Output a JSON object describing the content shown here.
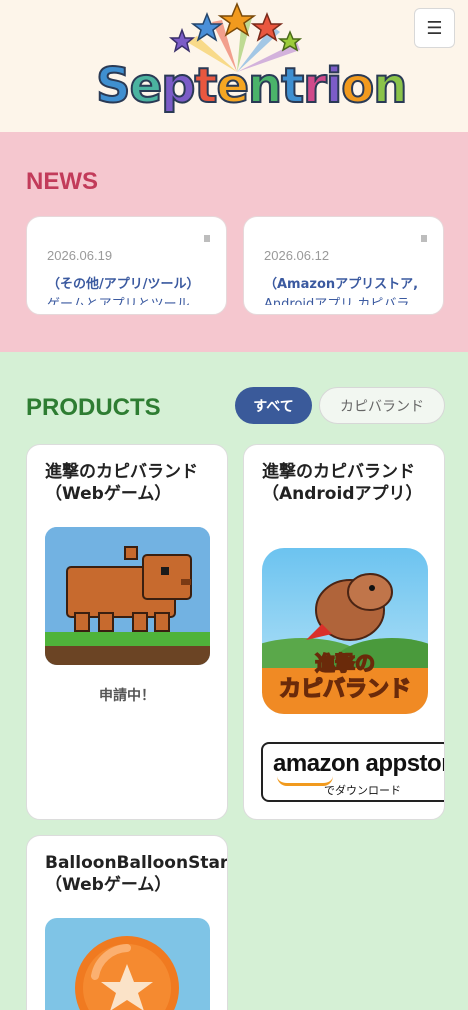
{
  "header": {
    "logo_text": "Septentrion",
    "menu_icon": "☰"
  },
  "news": {
    "title": "NEWS",
    "items": [
      {
        "date": "2026.06.19",
        "category": "（その他/アプリ/ツール）",
        "headline": "ゲームとアプリとツール"
      },
      {
        "date": "2026.06.12",
        "category": "（Amazonアプリストア,",
        "headline": "Androidアプリ,カピバラ"
      }
    ]
  },
  "products": {
    "title": "PRODUCTS",
    "filters": [
      "すべて",
      "カピバランド"
    ],
    "items": [
      {
        "title": "進撃のカピバランド（Webゲーム）",
        "status": "申請中！"
      },
      {
        "title": "進撃のカピバランド（Androidアプリ）",
        "badge_main": "amazon appstore",
        "badge_sub": "でダウンロード",
        "game_logo": "進撃の\nカピバランド"
      },
      {
        "title": "BalloonBalloonStars（Webゲーム）"
      }
    ]
  },
  "colors": {
    "news_bg": "#f5c7cf",
    "products_bg": "#d5f0d5",
    "accent_blue": "#3a5a9a"
  }
}
